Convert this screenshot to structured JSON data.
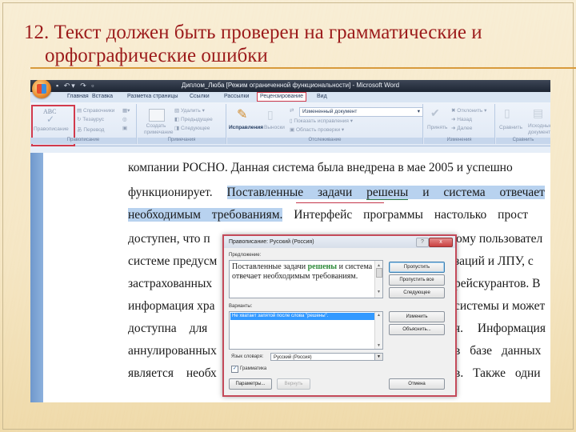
{
  "slide": {
    "title_line1": "12. Текст должен быть проверен на грамматические и",
    "title_line2": "орфографические ошибки",
    "colors": {
      "title": "#9c1b1b",
      "rule": "#d89a3c",
      "highlight_box": "#d23a4c"
    }
  },
  "word": {
    "window_title": "Диплом_Люба [Режим ограниченной функциональности] - Microsoft Word",
    "qat_icons": [
      "save-icon",
      "undo-icon",
      "redo-icon",
      "customize-icon"
    ],
    "tabs": [
      {
        "label": "Главная",
        "active": false
      },
      {
        "label": "Вставка",
        "active": false
      },
      {
        "label": "Разметка страницы",
        "active": false
      },
      {
        "label": "Ссылки",
        "active": false
      },
      {
        "label": "Рассылки",
        "active": false
      },
      {
        "label": "Рецензирование",
        "active": true
      },
      {
        "label": "Вид",
        "active": false
      }
    ],
    "ribbon": {
      "proofing": {
        "label": "Правописание",
        "spelling_button": "Правописание",
        "abc": "ABC",
        "research": "Справочники",
        "thesaurus": "Тезаурус",
        "translate": "Перевод"
      },
      "comments": {
        "label": "Примечания",
        "new_comment": "Создать примечание",
        "delete": "Удалить",
        "previous": "Предыдущее",
        "next": "Следующее"
      },
      "tracking": {
        "label": "Отслеживание",
        "track_changes": "Исправления",
        "balloons": "Выноски",
        "display_for_review": "Измененный документ",
        "show_markup": "Показать исправления",
        "reviewing_pane": "Область проверки"
      },
      "changes": {
        "label": "Изменения",
        "accept": "Принять",
        "reject": "Отклонить",
        "previous": "Назад",
        "next": "Далее"
      },
      "compare": {
        "label": "Сравнить",
        "compare": "Сравнить",
        "source": "Исходные документы"
      }
    },
    "document_lines": [
      {
        "text": "компании РОСНО. Данная система была внедрена в мае 2005 и успешно"
      },
      {
        "pre": "функционирует. ",
        "hl1": "Поставленные задачи ",
        "hl_err": "решены",
        "hl2": " и система отвечает"
      },
      {
        "hl": "необходимым требованиям.",
        "post": " Интерфейс программы настолько прост"
      },
      {
        "text": "доступен, что п"
      },
      {
        "text": "системе предусм"
      },
      {
        "text": "застрахованных"
      },
      {
        "text": "информация хра"
      },
      {
        "text": "доступна для"
      },
      {
        "text": "аннулированных"
      },
      {
        "text": "является необх"
      }
    ],
    "document_right": [
      "ому пользовател",
      "заций и ЛПУ, с",
      "рейскурантов. В",
      "системы и может",
      "я. Информация",
      "в базе данных",
      "в. Также одни"
    ]
  },
  "dialog": {
    "title": "Правописание: Русский (Россия)",
    "sentence_label": "Предложение:",
    "sentence_pre": "Поставленные задачи ",
    "sentence_error": "решены",
    "sentence_post": " и система отвечает необходимым требованиям.",
    "suggestions_label": "Варианты:",
    "suggestion_selected": "Не хватает запятой после слова \"решены\".",
    "buttons": {
      "ignore": "Пропустить",
      "ignore_all": "Пропустить все",
      "next": "Следующее",
      "change": "Изменить",
      "explain": "Объяснить...",
      "options": "Параметры...",
      "undo": "Вернуть",
      "cancel": "Отмена"
    },
    "dictionary_label": "Язык словаря:",
    "dictionary_value": "Русский (Россия)",
    "grammar_label": "Грамматика",
    "grammar_checked": true,
    "help": "?",
    "close": "x"
  }
}
